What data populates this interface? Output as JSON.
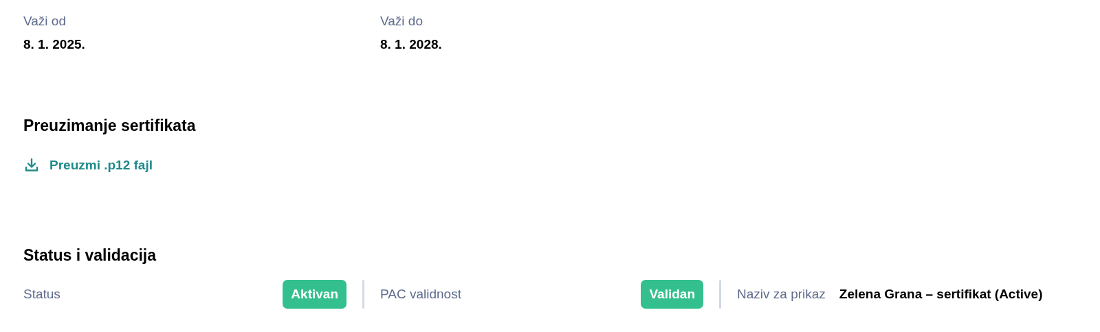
{
  "validity": [
    {
      "label": "Važi od",
      "value": "8. 1. 2025."
    },
    {
      "label": "Važi do",
      "value": "8. 1. 2028."
    }
  ],
  "download": {
    "title": "Preuzimanje sertifikata",
    "link": "Preuzmi .p12 fajl"
  },
  "status": {
    "title": "Status i validacija",
    "items": [
      {
        "label": "Status",
        "kind": "badge",
        "value": "Aktivan",
        "color": "#34c08e"
      },
      {
        "label": "PAC validnost",
        "kind": "badge",
        "value": "Validan",
        "color": "#34c08e"
      },
      {
        "label": "Naziv za prikaz",
        "kind": "text",
        "value": "Zelena Grana – sertifikat (Active)"
      }
    ]
  }
}
